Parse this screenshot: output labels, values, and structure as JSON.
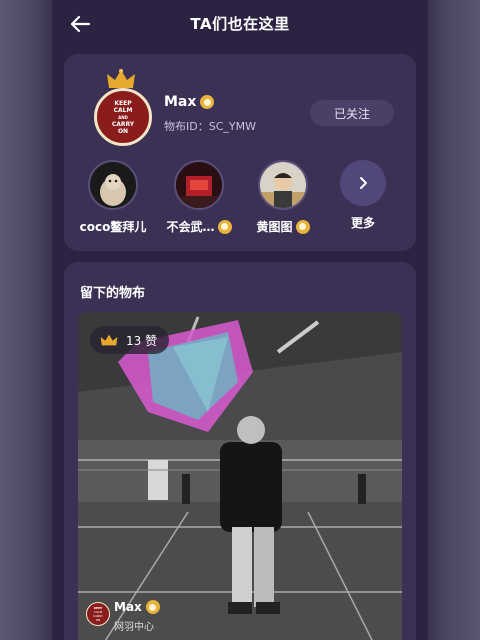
{
  "header": {
    "title": "TA们也在这里"
  },
  "profile": {
    "name": "Max",
    "id_text": "物布ID：SC_YMW",
    "avatar_lines": [
      "KEEP",
      "CALM",
      "AND",
      "CARRY",
      "ON"
    ],
    "follow_label": "已关注"
  },
  "friends": [
    {
      "label": "coco鳌拜儿",
      "verified": false
    },
    {
      "label": "不会武…",
      "verified": true
    },
    {
      "label": "黄图图",
      "verified": true
    }
  ],
  "more_label": "更多",
  "section": {
    "title": "留下的物布"
  },
  "post": {
    "likes": "13 赞",
    "author": "Max",
    "location": "网羽中心"
  },
  "colors": {
    "background": "#2c2343",
    "card": "#3b3155",
    "badge": "#e7b33b",
    "crown": "#e6a92b"
  }
}
